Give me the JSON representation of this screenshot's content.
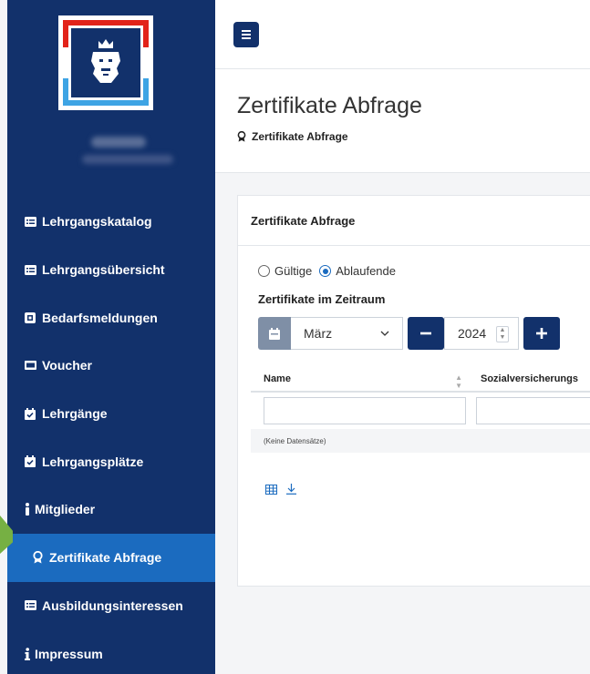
{
  "sidebar": {
    "items": [
      {
        "label": "Lehrgangskatalog",
        "icon": "list-card-icon"
      },
      {
        "label": "Lehrgangsübersicht",
        "icon": "list-card-icon"
      },
      {
        "label": "Bedarfsmeldungen",
        "icon": "cube-icon"
      },
      {
        "label": "Voucher",
        "icon": "ticket-icon"
      },
      {
        "label": "Lehrgänge",
        "icon": "calendar-check-icon"
      },
      {
        "label": "Lehrgangsplätze",
        "icon": "calendar-check-icon"
      },
      {
        "label": "Mitglieder",
        "icon": "person-icon"
      },
      {
        "label": "Zertifikate Abfrage",
        "icon": "award-icon",
        "active": true
      },
      {
        "label": "Ausbildungsinteressen",
        "icon": "list-card-icon"
      },
      {
        "label": "Impressum",
        "icon": "info-icon"
      }
    ]
  },
  "header": {
    "title": "Zertifikate Abfrage",
    "breadcrumb": "Zertifikate Abfrage"
  },
  "card": {
    "title": "Zertifikate Abfrage",
    "radio_valid": "Gültige",
    "radio_expiring": "Ablaufende",
    "period_label": "Zertifikate im Zeitraum",
    "month": "März",
    "year": "2024",
    "table": {
      "col_name": "Name",
      "col_svn": "Sozialversicherungs",
      "empty": "(Keine Datensätze)"
    }
  },
  "colors": {
    "sidebar": "#12316b",
    "active": "#1b6bbf",
    "arrow": "#7cb342"
  }
}
